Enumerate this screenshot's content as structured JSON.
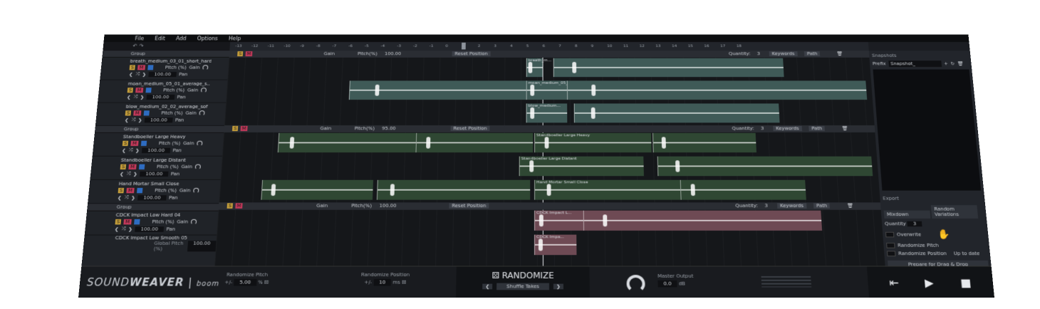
{
  "menu": [
    "File",
    "Edit",
    "Add",
    "Options",
    "Help"
  ],
  "ruler_ticks": [
    "-13",
    "-12",
    "-11",
    "-10",
    "-9",
    "-8",
    "-7",
    "-6",
    "-5",
    "-4",
    "-3",
    "-2",
    "-1",
    "0",
    "1",
    "2",
    "3",
    "4",
    "5",
    "6",
    "7",
    "8",
    "9",
    "10",
    "11",
    "12",
    "13",
    "14",
    "15",
    "16",
    "17",
    "18"
  ],
  "groups": [
    {
      "label": "Group",
      "controls": {
        "gain_label": "Gain",
        "pitch_label": "Pitch(%)",
        "pitch_value": "100.00",
        "reset": "Reset Position",
        "quantity_label": "Quantity:",
        "quantity": "3",
        "keywords": "Keywords",
        "path": "Path"
      },
      "tracks": [
        {
          "name": "breath_medium_03_01_short_hard",
          "pitch_label": "Pitch (%)",
          "gain_label": "Gain",
          "pitch_value": "100.00",
          "pan_label": "Pan"
        },
        {
          "name": "moan_medium_05_01_average_s...",
          "pitch_label": "Pitch (%)",
          "gain_label": "Gain",
          "pitch_value": "100.00",
          "pan_label": "Pan"
        },
        {
          "name": "blow_medium_02_02_average_soft",
          "pitch_label": "Pitch (%)",
          "gain_label": "Gain",
          "pitch_value": "100.00",
          "pan_label": "Pan"
        }
      ],
      "clip_labels": [
        "breath_m...",
        "moan_medium_05_01...",
        "blow_medium..."
      ]
    },
    {
      "label": "Group",
      "controls": {
        "gain_label": "Gain",
        "pitch_label": "Pitch(%)",
        "pitch_value": "95.00",
        "reset": "Reset Position",
        "quantity_label": "Quantity:",
        "quantity": "3",
        "keywords": "Keywords",
        "path": "Path"
      },
      "tracks": [
        {
          "name": "Standboeller Large Heavy",
          "pitch_label": "Pitch (%)",
          "gain_label": "Gain",
          "pitch_value": "100.00",
          "pan_label": "Pan"
        },
        {
          "name": "Standboeller Large Distant",
          "pitch_label": "Pitch (%)",
          "gain_label": "Gain",
          "pitch_value": "100.00",
          "pan_label": "Pan"
        },
        {
          "name": "Hand Mortar Small Close",
          "pitch_label": "Pitch (%)",
          "gain_label": "Gain",
          "pitch_value": "100.00",
          "pan_label": "Pan"
        }
      ],
      "clip_labels": [
        "Standboeller Large Heavy",
        "Standboeller Large Distant",
        "Hand Mortar Small Close"
      ]
    },
    {
      "label": "Group",
      "controls": {
        "gain_label": "Gain",
        "pitch_label": "Pitch(%)",
        "pitch_value": "100.00",
        "reset": "Reset Position",
        "quantity_label": "Quantity:",
        "quantity": "3",
        "keywords": "Keywords",
        "path": "Path"
      },
      "tracks": [
        {
          "name": "CDCK Impact Low Hard 04",
          "pitch_label": "Pitch (%)",
          "gain_label": "Gain",
          "pitch_value": "100.00",
          "pan_label": "Pan"
        },
        {
          "name": "CDCK Impact Low Smooth 05"
        }
      ],
      "clip_labels": [
        "CDCK Impact L...",
        "CDCK Impa..."
      ]
    }
  ],
  "global_pitch": {
    "label": "Global Pitch (%)",
    "value": "100.00"
  },
  "snapshots": {
    "title": "Snapshots",
    "prefix_label": "Prefix",
    "prefix_value": "Snapshot_"
  },
  "export": {
    "title": "Export",
    "mode": "Mixdown",
    "variation": "Random Variations",
    "quantity_label": "Quantity",
    "quantity": "3",
    "options": [
      "Overwrite",
      "Randomize Pitch",
      "Randomize Position"
    ],
    "status": "Up to date",
    "prepare": "Prepare for Drag & Drop"
  },
  "footer": {
    "logo_light": "SOUND",
    "logo_bold": "WEAVER",
    "brand": "boom",
    "rand_pitch_label": "Randomize Pitch",
    "rand_pitch_prefix": "+/-",
    "rand_pitch_value": "5.00",
    "rand_pitch_unit": "%",
    "rand_pos_label": "Randomize Position",
    "rand_pos_prefix": "+/-",
    "rand_pos_value": "10",
    "rand_pos_unit": "ms",
    "randomize": "RANDOMIZE",
    "shuffle": "Shuffle Takes",
    "master_label": "Master Output",
    "master_value": "0.0",
    "master_unit": "dB"
  },
  "icons": [
    "dice-icon",
    "play-icon",
    "stop-icon",
    "hand-icon",
    "folder-icon",
    "trash-icon",
    "knob-icon",
    "shuffle-icon"
  ]
}
